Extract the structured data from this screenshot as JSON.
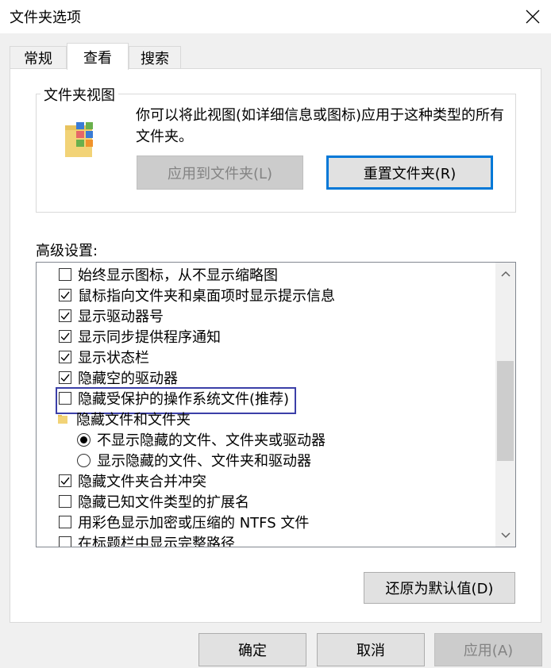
{
  "window": {
    "title": "文件夹选项"
  },
  "tabs": [
    {
      "label": "常规",
      "active": false
    },
    {
      "label": "查看",
      "active": true
    },
    {
      "label": "搜索",
      "active": false
    }
  ],
  "folder_views": {
    "legend": "文件夹视图",
    "description": "你可以将此视图(如详细信息或图标)应用于这种类型的所有文件夹。",
    "apply_button": "应用到文件夹(L)",
    "reset_button": "重置文件夹(R)"
  },
  "advanced": {
    "label": "高级设置:",
    "items": [
      {
        "type": "checkbox",
        "checked": false,
        "label": "始终显示图标，从不显示缩略图"
      },
      {
        "type": "checkbox",
        "checked": true,
        "label": "鼠标指向文件夹和桌面项时显示提示信息"
      },
      {
        "type": "checkbox",
        "checked": true,
        "label": "显示驱动器号"
      },
      {
        "type": "checkbox",
        "checked": true,
        "label": "显示同步提供程序通知"
      },
      {
        "type": "checkbox",
        "checked": true,
        "label": "显示状态栏"
      },
      {
        "type": "checkbox",
        "checked": true,
        "label": "隐藏空的驱动器"
      },
      {
        "type": "checkbox",
        "checked": false,
        "label": "隐藏受保护的操作系统文件(推荐)",
        "focused": true
      },
      {
        "type": "folder",
        "label": "隐藏文件和文件夹"
      },
      {
        "type": "radio",
        "checked": true,
        "label": "不显示隐藏的文件、文件夹或驱动器"
      },
      {
        "type": "radio",
        "checked": false,
        "label": "显示隐藏的文件、文件夹和驱动器"
      },
      {
        "type": "checkbox",
        "checked": true,
        "label": "隐藏文件夹合并冲突"
      },
      {
        "type": "checkbox",
        "checked": false,
        "label": "隐藏已知文件类型的扩展名"
      },
      {
        "type": "checkbox",
        "checked": false,
        "label": "用彩色显示加密或压缩的 NTFS 文件"
      },
      {
        "type": "checkbox",
        "checked": false,
        "label": "在标题栏中显示完整路径"
      }
    ],
    "scrollbar": {
      "position": 0.45
    }
  },
  "restore_button": "还原为默认值(D)",
  "footer": {
    "ok": "确定",
    "cancel": "取消",
    "apply": "应用(A)"
  }
}
